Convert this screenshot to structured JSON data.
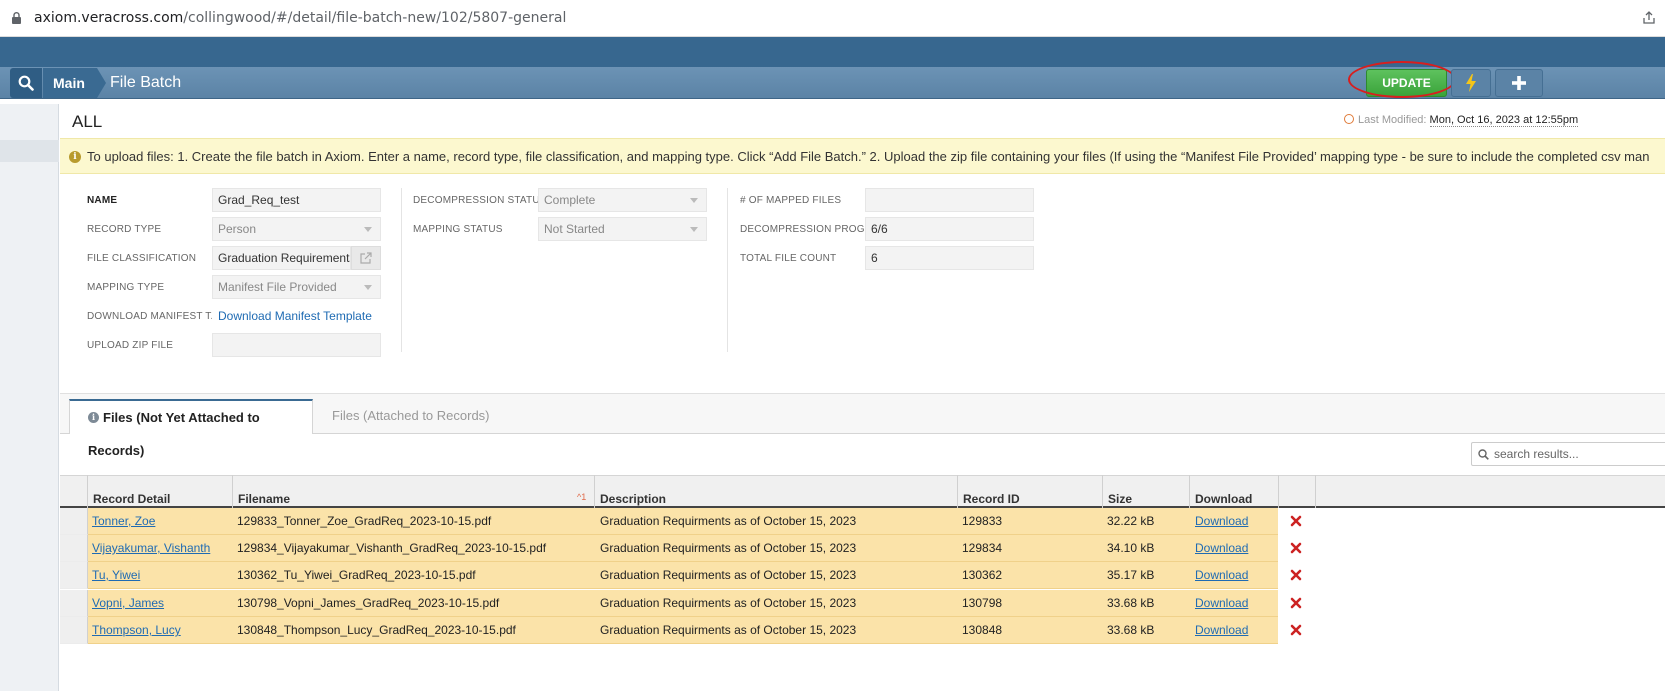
{
  "browser": {
    "url_host": "axiom.veracross.com",
    "url_path": "/collingwood/#/detail/file-batch-new/102/5807-general"
  },
  "nav": {
    "breadcrumb_main": "Main",
    "page_name": "File Batch",
    "update_label": "UPDATE"
  },
  "header": {
    "title": "ALL",
    "last_modified_label": "Last Modified:",
    "last_modified_value": "Mon, Oct 16, 2023 at 12:55pm"
  },
  "info_banner": "To upload files: 1. Create the file batch in Axiom. Enter a name, record type, file classification, and mapping type. Click “Add File Batch.” 2. Upload the zip file containing your files (If using the “Manifest File Provided’ mapping type - be sure to include the completed csv man",
  "form": {
    "name_label": "NAME",
    "name_value": "Grad_Req_test",
    "record_type_label": "RECORD TYPE",
    "record_type_value": "Person",
    "file_classification_label": "FILE CLASSIFICATION",
    "file_classification_value": "Graduation Requirements",
    "mapping_type_label": "MAPPING TYPE",
    "mapping_type_value": "Manifest File Provided",
    "download_manifest_label": "DOWNLOAD MANIFEST T...",
    "download_manifest_link": "Download Manifest Template",
    "upload_zip_label": "UPLOAD ZIP FILE",
    "upload_zip_value": "",
    "decompression_status_label": "DECOMPRESSION STATUS",
    "decompression_status_value": "Complete",
    "mapping_status_label": "MAPPING STATUS",
    "mapping_status_value": "Not Started",
    "mapped_files_label": "# OF MAPPED FILES",
    "mapped_files_value": "",
    "decompression_progress_label": "DECOMPRESSION PROGR...",
    "decompression_progress_value": "6/6",
    "total_file_count_label": "TOTAL FILE COUNT",
    "total_file_count_value": "6"
  },
  "tabs": {
    "active": "Files (Not Yet Attached to Records)",
    "inactive": "Files (Attached to Records)"
  },
  "search": {
    "placeholder": "search results..."
  },
  "grid": {
    "columns": {
      "record_detail": "Record Detail",
      "filename": "Filename",
      "sort_indicator": "^1",
      "description": "Description",
      "record_id": "Record ID",
      "size": "Size",
      "download": "Download"
    },
    "rows": [
      {
        "record": "Tonner, Zoe",
        "filename": "129833_Tonner_Zoe_GradReq_2023-10-15.pdf",
        "description": "Graduation Requirments as of October 15, 2023",
        "record_id": "129833",
        "size": "32.22 kB",
        "download": "Download"
      },
      {
        "record": "Vijayakumar, Vishanth",
        "filename": "129834_Vijayakumar_Vishanth_GradReq_2023-10-15.pdf",
        "description": "Graduation Requirments as of October 15, 2023",
        "record_id": "129834",
        "size": "34.10 kB",
        "download": "Download"
      },
      {
        "record": "Tu, Yiwei",
        "filename": "130362_Tu_Yiwei_GradReq_2023-10-15.pdf",
        "description": "Graduation Requirments as of October 15, 2023",
        "record_id": "130362",
        "size": "35.17 kB",
        "download": "Download"
      },
      {
        "record": "Vopni, James",
        "filename": "130798_Vopni_James_GradReq_2023-10-15.pdf",
        "description": "Graduation Requirments as of October 15, 2023",
        "record_id": "130798",
        "size": "33.68 kB",
        "download": "Download"
      },
      {
        "record": "Thompson, Lucy",
        "filename": "130848_Thompson_Lucy_GradReq_2023-10-15.pdf",
        "description": "Graduation Requirments as of October 15, 2023",
        "record_id": "130848",
        "size": "33.68 kB",
        "download": "Download"
      }
    ]
  },
  "colors": {
    "nav_blue": "#5b83a6",
    "update_green": "#3aa33a",
    "row_highlight": "#fbe3a9",
    "banner_yellow": "#fcf8cf",
    "delete_red": "#cc2222",
    "annotation_red": "#d81e1e"
  },
  "icons": {
    "search": "search-icon",
    "bolt": "lightning-icon",
    "plus": "plus-icon",
    "delete": "close-icon",
    "external": "external-link-icon"
  }
}
